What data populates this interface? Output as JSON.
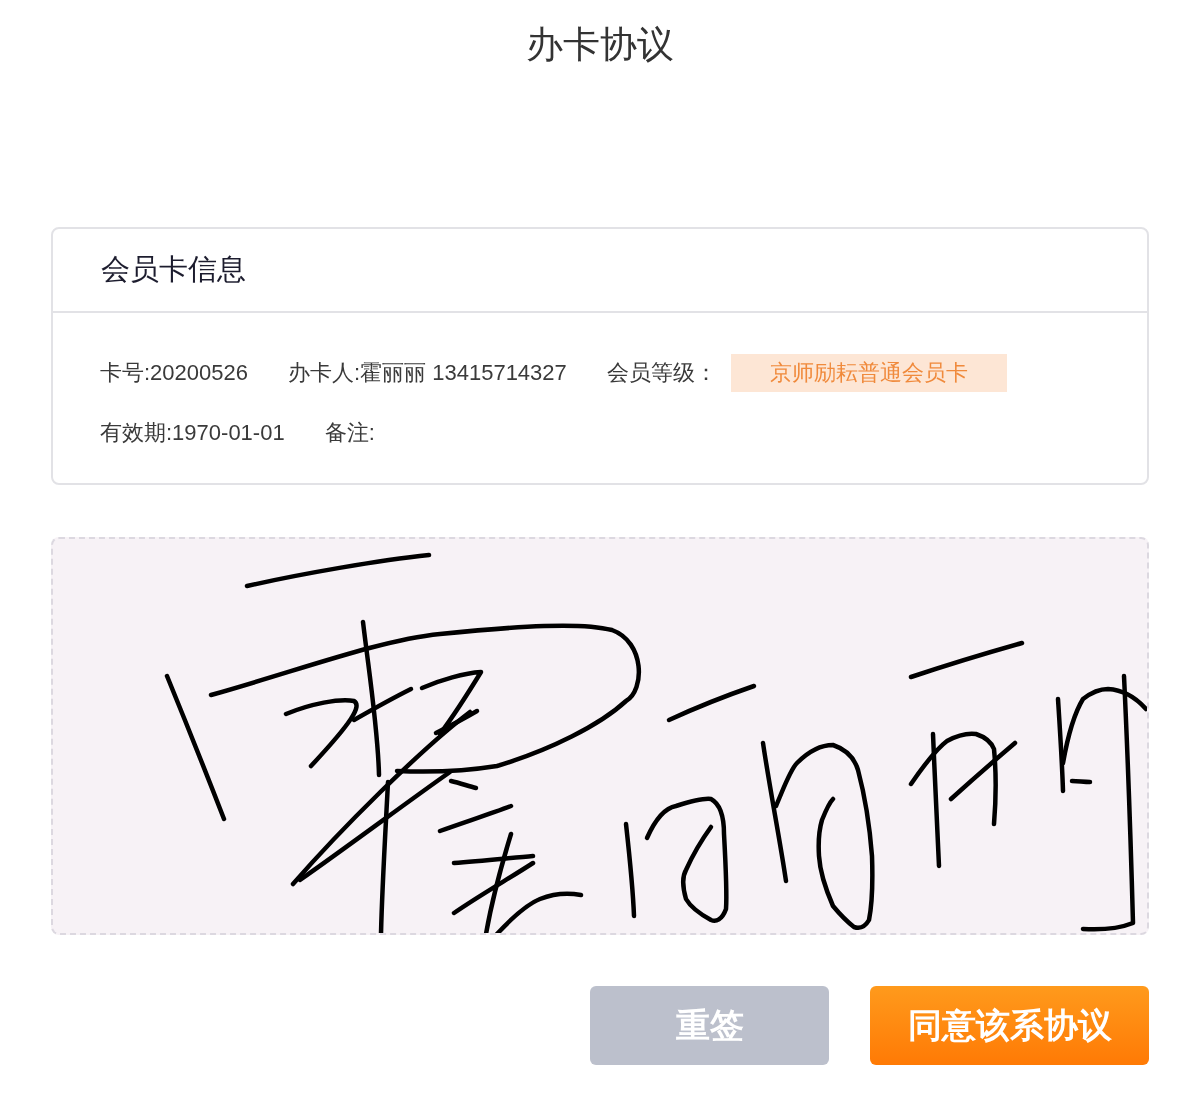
{
  "page": {
    "title": "办卡协议"
  },
  "card": {
    "title": "会员卡信息",
    "rows": [
      {
        "fields": [
          {
            "kind": "text",
            "text": "卡号:20200526"
          },
          {
            "kind": "text",
            "text": "办卡人:霍丽丽 13415714327"
          },
          {
            "kind": "tagged",
            "text": "会员等级：",
            "tag": "京师励耘普通会员卡"
          }
        ]
      },
      {
        "fields": [
          {
            "kind": "text",
            "text": "有效期:1970-01-01"
          },
          {
            "kind": "text",
            "text": "备注:"
          }
        ]
      }
    ]
  },
  "signature_pad": {
    "signed": true
  },
  "buttons": [
    {
      "kind": "secondary",
      "label": "重签"
    },
    {
      "kind": "primary",
      "label": "同意该系协议"
    }
  ]
}
